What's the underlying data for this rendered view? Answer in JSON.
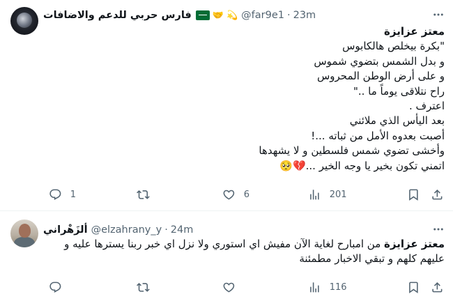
{
  "tweets": [
    {
      "author": {
        "display_name": "فارس حربي للدعم والاضافات",
        "badges": [
          "🤝",
          "💫"
        ],
        "handle": "@far9e1",
        "separator": "·",
        "time": "23m"
      },
      "mention": "معتز عزايزة",
      "lines": [
        "\"بكرة بيخلص هالكابوس",
        "و بدل الشمس بتضوي شموس",
        "و على أرض الوطن المحروس",
        "راح نتلاقى يوماً ما ..\"",
        "اعترف .",
        "بعد اليأس الذي ملائني",
        "أصبت بعدوه الأمل من ثباته ...!",
        "وأخشى تضوي شمس فلسطين و لا يشهدها",
        "اتمني تكون بخير يا وجه الخير ...💔🥺"
      ],
      "stats": {
        "replies": "1",
        "retweets": "",
        "likes": "6",
        "views": "201"
      }
    },
    {
      "author": {
        "display_name": "ألزَهْراني",
        "handle": "@elzahrany_y",
        "separator": "·",
        "time": "24m"
      },
      "mention": "معتز عزايزة",
      "lines": [
        "من امبارح لغاية الآن مفيش اي استوري ولا نزل اي خبر ربنا يسترها عليه و",
        "عليهم كلهم و تبقي الاخبار مطمئنة"
      ],
      "stats": {
        "replies": "",
        "retweets": "",
        "likes": "",
        "views": "116"
      }
    }
  ],
  "icons": {
    "reply": "reply-icon",
    "retweet": "retweet-icon",
    "like": "like-icon",
    "views": "views-icon",
    "bookmark": "bookmark-icon",
    "share": "share-icon",
    "more": "more-icon"
  },
  "colors": {
    "secondary_text": "#536471",
    "primary_text": "#0f1419",
    "divider": "#eff3f4",
    "flag_green": "#006c35"
  }
}
